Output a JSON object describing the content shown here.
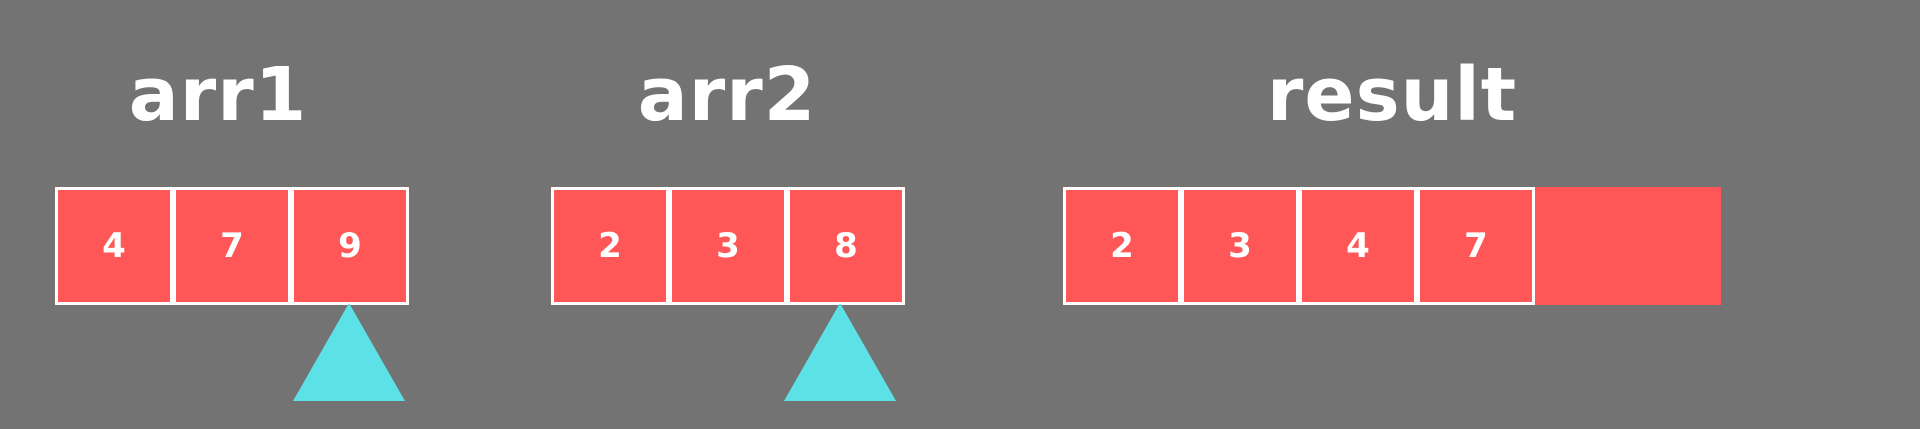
{
  "colors": {
    "background": "#737373",
    "cell_fill": "#ff5757",
    "cell_border": "#ffffff",
    "pointer": "#5ce1e6",
    "text": "#ffffff"
  },
  "arr1": {
    "title": "arr1",
    "cells": [
      "4",
      "7",
      "9"
    ],
    "pointer_index": 2
  },
  "arr2": {
    "title": "arr2",
    "cells": [
      "2",
      "3",
      "8"
    ],
    "pointer_index": 2
  },
  "result": {
    "title": "result",
    "cells": [
      "2",
      "3",
      "4",
      "7",
      ""
    ]
  }
}
